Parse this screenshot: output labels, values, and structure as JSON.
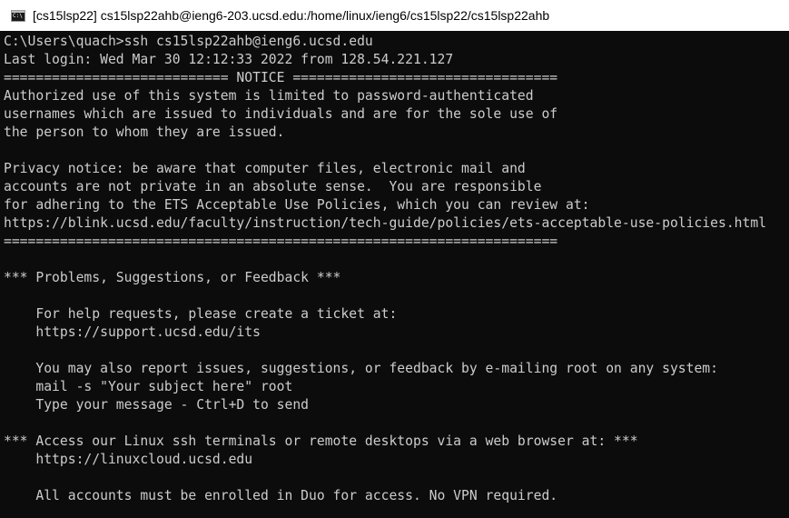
{
  "window": {
    "title": "[cs15lsp22]  cs15lsp22ahb@ieng6-203.ucsd.edu:/home/linux/ieng6/cs15lsp22/cs15lsp22ahb",
    "icon": "command-prompt-icon",
    "icon_glyph": "C:\\"
  },
  "colors": {
    "background": "#0c0c0c",
    "text": "#cccccc",
    "titlebar": "#ffffff"
  },
  "terminal": {
    "lines": [
      "C:\\Users\\quach>ssh cs15lsp22ahb@ieng6.ucsd.edu",
      "Last login: Wed Mar 30 12:12:33 2022 from 128.54.221.127",
      "============================ NOTICE =================================",
      "Authorized use of this system is limited to password-authenticated",
      "usernames which are issued to individuals and are for the sole use of",
      "the person to whom they are issued.",
      "",
      "Privacy notice: be aware that computer files, electronic mail and",
      "accounts are not private in an absolute sense.  You are responsible",
      "for adhering to the ETS Acceptable Use Policies, which you can review at:",
      "https://blink.ucsd.edu/faculty/instruction/tech-guide/policies/ets-acceptable-use-policies.html",
      "=====================================================================",
      "",
      "*** Problems, Suggestions, or Feedback ***",
      "",
      "    For help requests, please create a ticket at:",
      "    https://support.ucsd.edu/its",
      "",
      "    You may also report issues, suggestions, or feedback by e-mailing root on any system:",
      "    mail -s \"Your subject here\" root",
      "    Type your message - Ctrl+D to send",
      "",
      "*** Access our Linux ssh terminals or remote desktops via a web browser at: ***",
      "    https://linuxcloud.ucsd.edu",
      "",
      "    All accounts must be enrolled in Duo for access. No VPN required."
    ]
  }
}
